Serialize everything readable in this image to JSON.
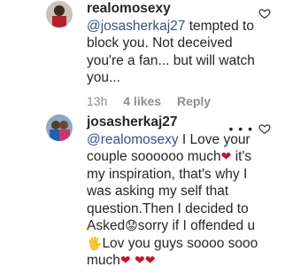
{
  "comments": [
    {
      "username": "realomosexy",
      "mention": "@josasherkaj27",
      "text": " tempted to block you. Not deceived you're a fan... but will watch you...",
      "time": "13h",
      "likes": "4 likes",
      "reply": "Reply",
      "icons": {
        "like": "heart-outline-icon"
      }
    },
    {
      "username": "josasherkaj27",
      "mention": "@realomosexy",
      "text_part_1": " I Love your couple soooooo much",
      "text_part_2": " it's my inspiration, that's why I was asking my self that question.Then I decided to Asked",
      "text_part_3": "sorry if I offended u",
      "text_part_4": "Lov you guys soooo sooo much",
      "emoji_heart": "❤",
      "emoji_sad": "😟",
      "emoji_hand": "🖐",
      "icons": {
        "like": "heart-outline-icon",
        "more": "more-options-icon"
      },
      "more": "• • •"
    }
  ],
  "colors": {
    "text": "#262626",
    "mention": "#385185",
    "meta": "#8e8e8e",
    "heart_red": "#c0172b"
  }
}
